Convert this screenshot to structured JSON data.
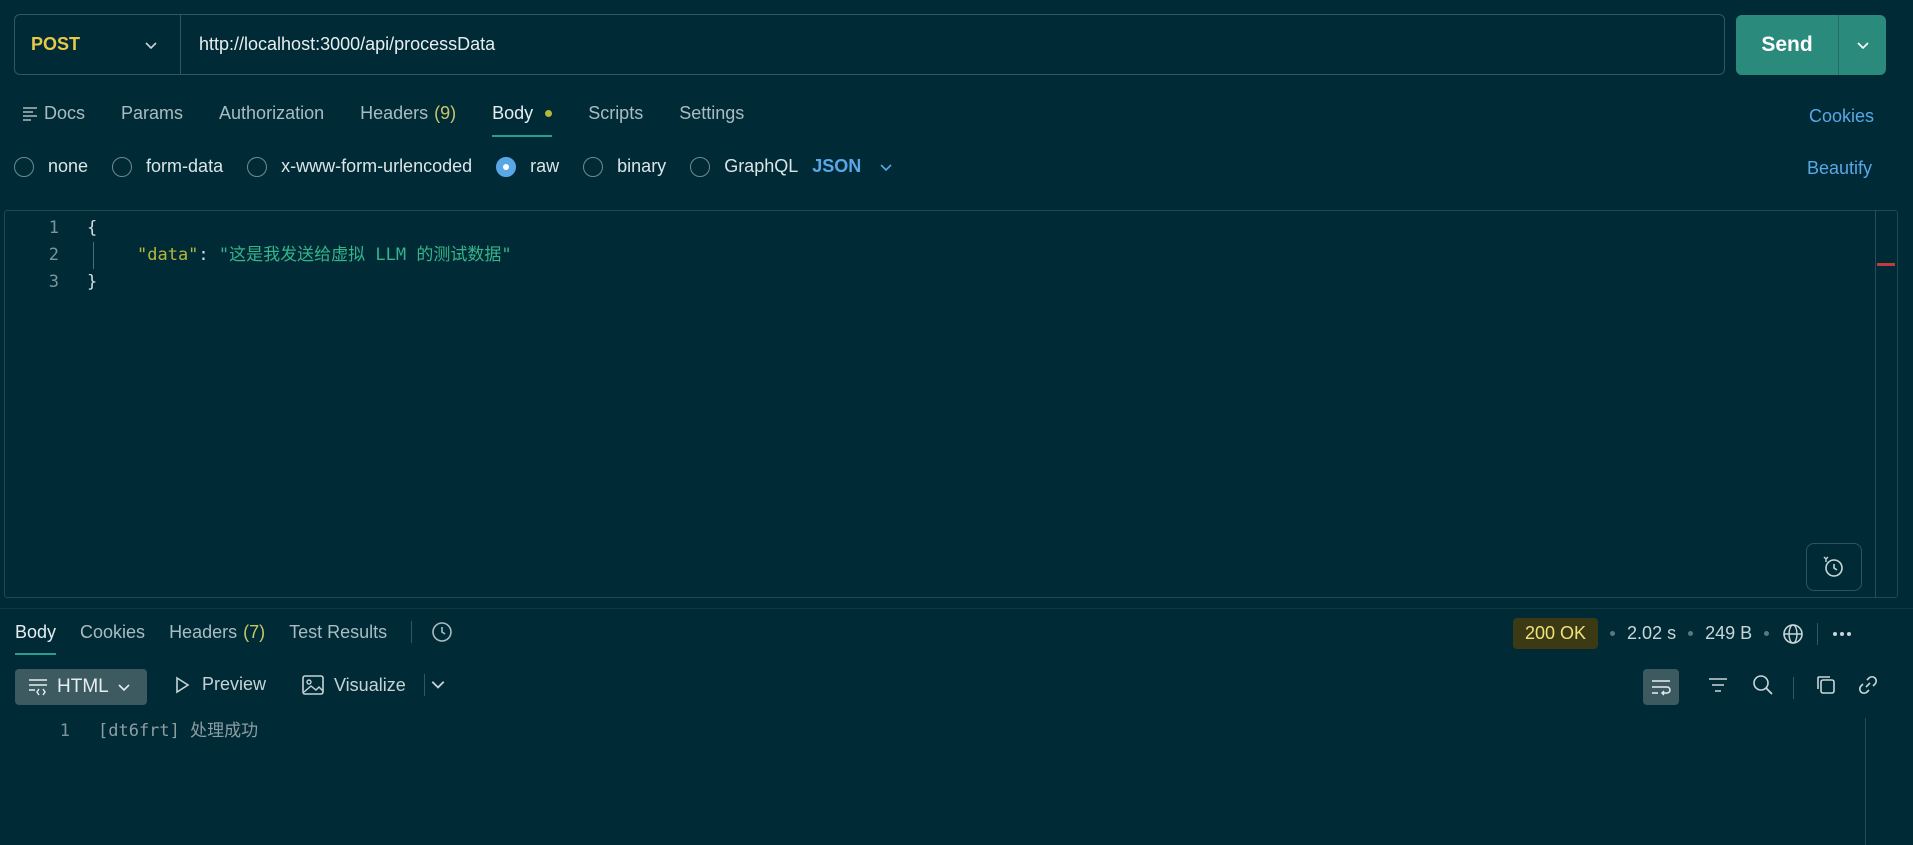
{
  "request": {
    "method": "POST",
    "url": "http://localhost:3000/api/processData",
    "send_label": "Send"
  },
  "req_tabs": {
    "docs": "Docs",
    "params": "Params",
    "authorization": "Authorization",
    "headers": "Headers",
    "headers_count": "(9)",
    "body": "Body",
    "scripts": "Scripts",
    "settings": "Settings",
    "cookies": "Cookies"
  },
  "body_modes": {
    "none": "none",
    "form_data": "form-data",
    "urlencoded": "x-www-form-urlencoded",
    "raw": "raw",
    "binary": "binary",
    "graphql": "GraphQL",
    "format": "JSON",
    "beautify": "Beautify",
    "selected": "raw"
  },
  "editor": {
    "lines": [
      {
        "n": "1",
        "text": "{"
      },
      {
        "n": "2",
        "key": "\"data\"",
        "colon": ": ",
        "value": "\"这是我发送给虚拟 LLM 的测试数据\""
      },
      {
        "n": "3",
        "text": "}"
      }
    ]
  },
  "response": {
    "tabs": {
      "body": "Body",
      "cookies": "Cookies",
      "headers": "Headers",
      "headers_count": "(7)",
      "test_results": "Test Results"
    },
    "status": "200 OK",
    "time": "2.02 s",
    "size": "249 B",
    "format": "HTML",
    "preview": "Preview",
    "visualize": "Visualize",
    "lines": [
      {
        "n": "1",
        "text": "[dt6frt] 处理成功"
      }
    ]
  },
  "colors": {
    "background": "#002b36",
    "send": "#2a8a7c",
    "post": "#e6c84a",
    "link": "#5aa7e6",
    "status_badge": "#3b3a14"
  }
}
